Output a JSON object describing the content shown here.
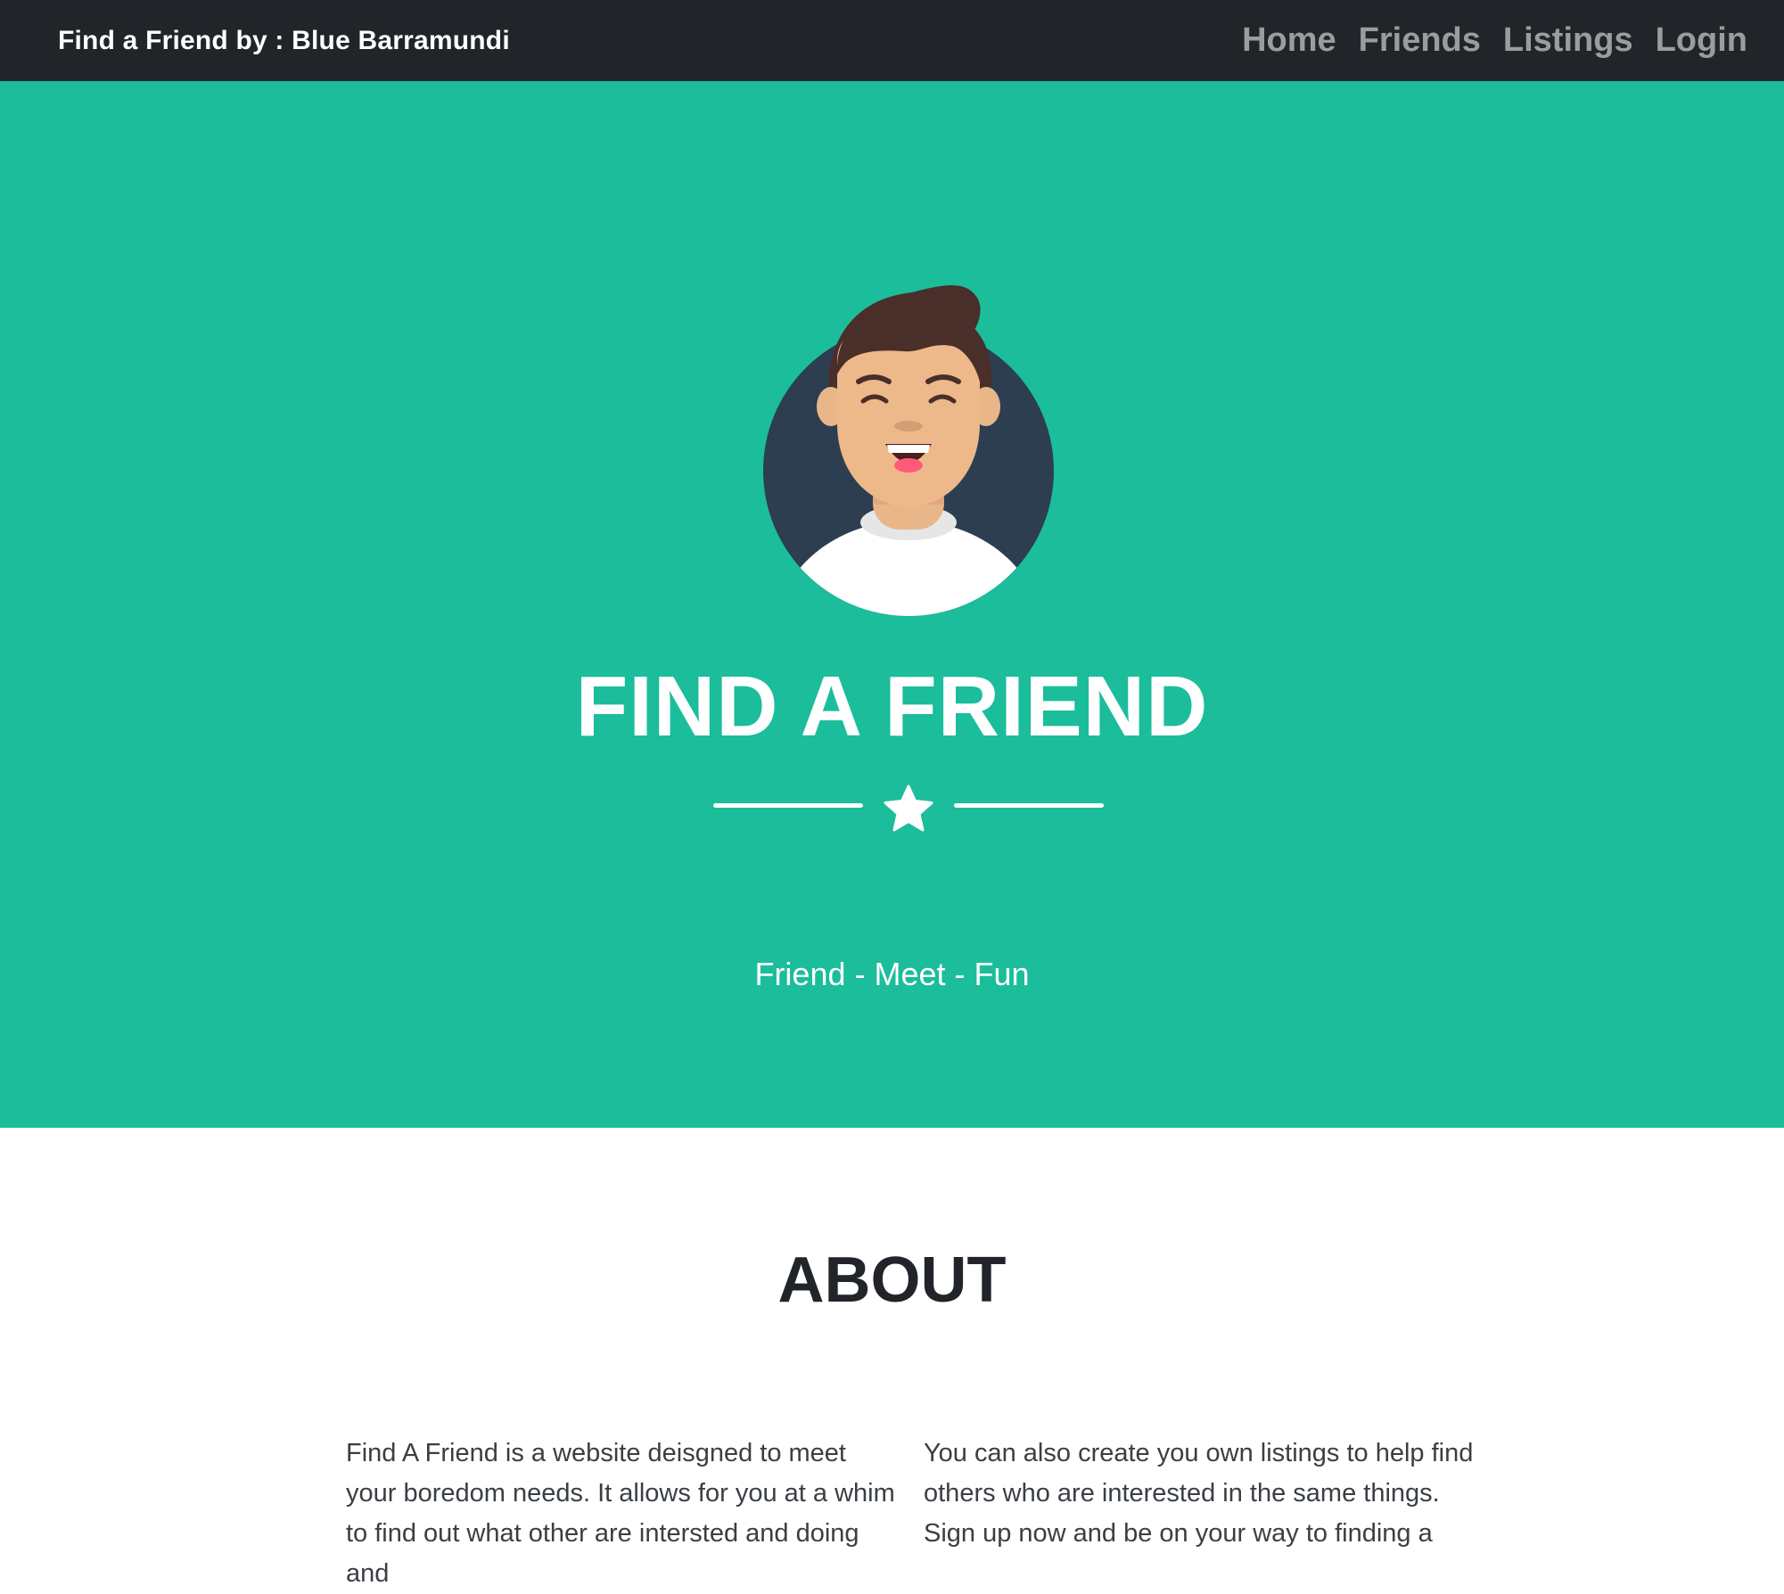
{
  "navbar": {
    "brand": "Find a Friend by : Blue Barramundi",
    "links": [
      {
        "label": "Home"
      },
      {
        "label": "Friends"
      },
      {
        "label": "Listings"
      },
      {
        "label": "Login"
      }
    ],
    "background": "#212529",
    "link_color": "#9a9da0"
  },
  "hero": {
    "title": "FIND A FRIEND",
    "tagline": "Friend - Meet - Fun",
    "background": "#1bbd9b",
    "avatar_icon": "smiling-man-avatar-icon",
    "divider_icon": "star-icon"
  },
  "about": {
    "title": "ABOUT",
    "col_left": "Find A Friend is a website deisgned to meet your boredom needs. It allows for you at a whim to find out what other are intersted and doing and",
    "col_right": "You can also create you own listings to help find others who are interested in the same things. Sign up now and be on your way to finding a"
  }
}
